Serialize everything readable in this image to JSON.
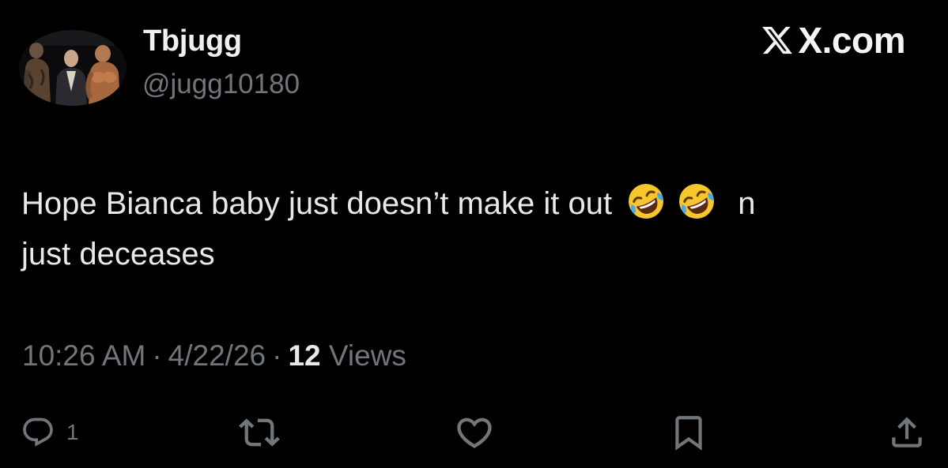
{
  "tweet": {
    "author": {
      "display_name": "Tbjugg",
      "handle": "@jugg10180"
    },
    "brand": "X.com",
    "text_line1": "Hope Bianca baby just doesn’t make it out",
    "emoji_name": "rolling-on-the-floor-laughing",
    "emoji_count": 2,
    "text_tail": "n",
    "text_line2": "just deceases",
    "time": "10:26 AM",
    "date": "4/22/26",
    "separator": "·",
    "views_count": "12",
    "views_label": "Views",
    "reply_count": "1"
  },
  "icons": [
    "x-logo-icon",
    "reply-icon",
    "retweet-icon",
    "like-icon",
    "bookmark-icon",
    "share-icon"
  ],
  "colors": {
    "background": "#000000",
    "text_primary": "#e7e9ea",
    "text_secondary": "#71767b"
  }
}
